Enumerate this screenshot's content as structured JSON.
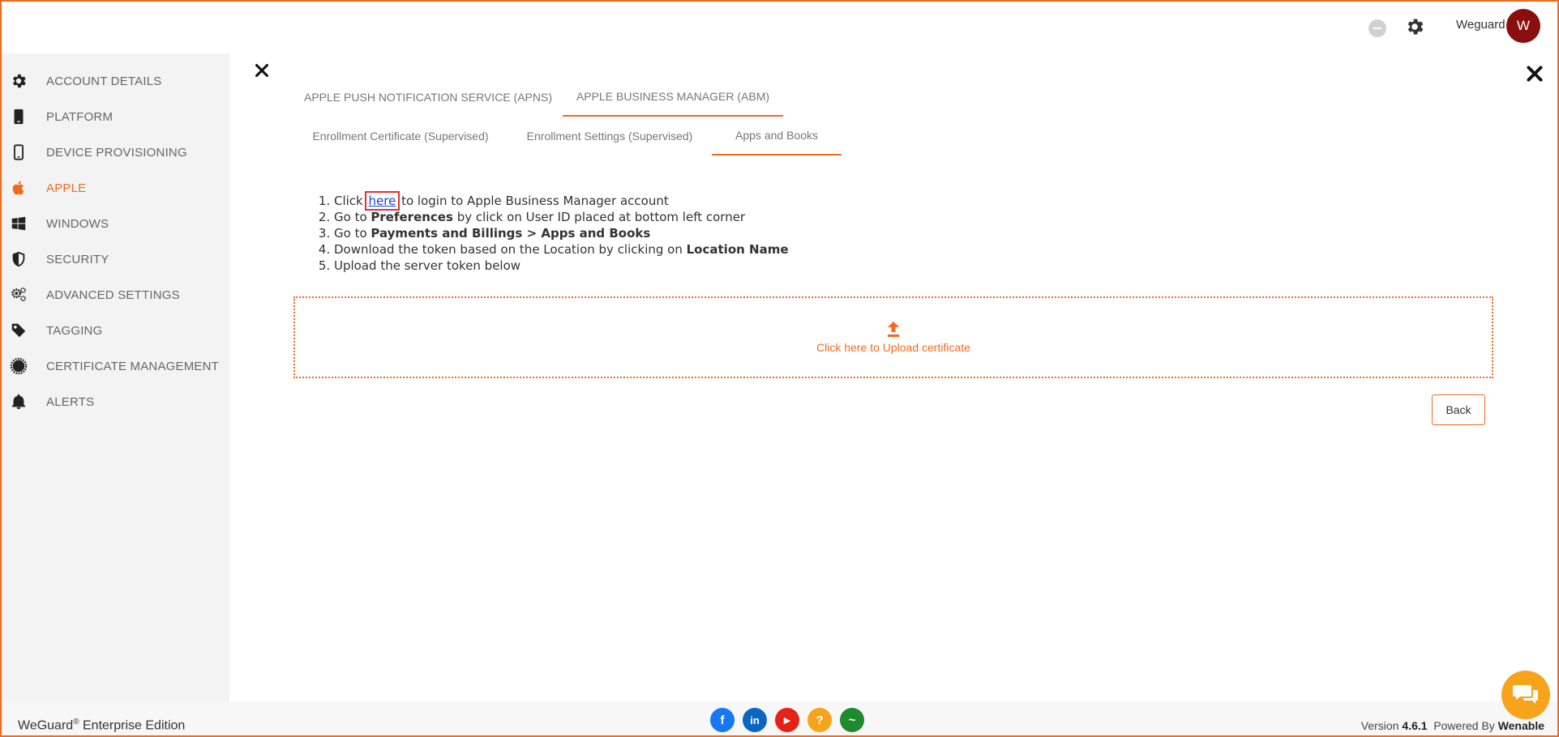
{
  "header": {
    "user_name": "Weguard",
    "avatar_letter": "W"
  },
  "sidebar": {
    "items": [
      {
        "label": "ACCOUNT DETAILS",
        "icon": "gear-icon"
      },
      {
        "label": "PLATFORM",
        "icon": "phone-icon"
      },
      {
        "label": "DEVICE PROVISIONING",
        "icon": "mobile-outline-icon"
      },
      {
        "label": "APPLE",
        "icon": "apple-icon",
        "active": true
      },
      {
        "label": "WINDOWS",
        "icon": "windows-icon"
      },
      {
        "label": "SECURITY",
        "icon": "shield-icon"
      },
      {
        "label": "ADVANCED SETTINGS",
        "icon": "gears-icon"
      },
      {
        "label": "TAGGING",
        "icon": "tag-icon"
      },
      {
        "label": "CERTIFICATE MANAGEMENT",
        "icon": "certificate-icon"
      },
      {
        "label": "ALERTS",
        "icon": "bell-icon"
      }
    ]
  },
  "tabs": {
    "primary": [
      {
        "label": "APPLE PUSH NOTIFICATION SERVICE (APNS)"
      },
      {
        "label": "APPLE BUSINESS MANAGER (ABM)",
        "active": true
      }
    ],
    "secondary": [
      {
        "label": "Enrollment Certificate (Supervised)"
      },
      {
        "label": "Enrollment Settings (Supervised)"
      },
      {
        "label": "Apps and Books",
        "active": true
      }
    ]
  },
  "instructions": {
    "step1_pre": "Click ",
    "step1_link": "here",
    "step1_post": " to login to Apple Business Manager account",
    "step2_pre": "Go to ",
    "step2_bold": "Preferences",
    "step2_post": " by click on User ID placed at bottom left corner",
    "step3_pre": "Go to ",
    "step3_bold": "Payments and Billings > Apps and Books",
    "step4_pre": "Download the token based on the Location by clicking on ",
    "step4_bold": "Location Name",
    "step5": "Upload the server token below"
  },
  "upload": {
    "label": "Click here to Upload certificate"
  },
  "back_label": "Back",
  "footer": {
    "brand": "WeGuard",
    "brand_sup": "®",
    "edition": " Enterprise Edition",
    "version_prefix": "Version ",
    "version": "4.6.1",
    "powered_prefix": "Powered By ",
    "powered_by": "Wenable",
    "social": [
      {
        "icon": "facebook-icon",
        "glyph": "f",
        "color": "#1877f2"
      },
      {
        "icon": "linkedin-icon",
        "glyph": "in",
        "color": "#0a66c2"
      },
      {
        "icon": "youtube-icon",
        "glyph": "▶",
        "color": "#e62117"
      },
      {
        "icon": "help-icon",
        "glyph": "?",
        "color": "#f7a41d"
      },
      {
        "icon": "activity-icon",
        "glyph": "~",
        "color": "#1e8a2e"
      }
    ]
  },
  "colors": {
    "accent": "#f26b1d",
    "avatar": "#8b0e0e",
    "link": "#1a3fd6"
  }
}
